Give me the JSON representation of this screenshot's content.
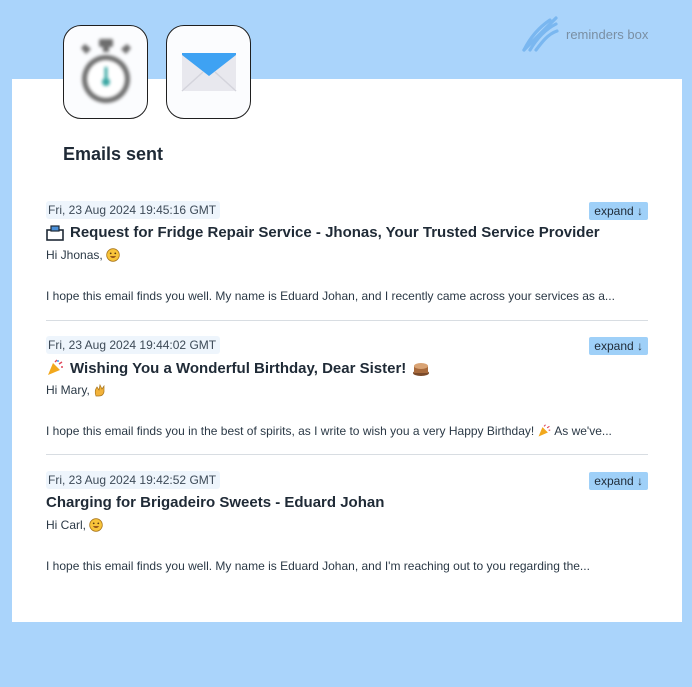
{
  "brand": {
    "label": "reminders box",
    "icon": "feather-logo-icon",
    "color": "#7ab7f0"
  },
  "tiles": [
    {
      "name": "timer",
      "icon": "stopwatch-icon"
    },
    {
      "name": "mail",
      "icon": "envelope-icon"
    }
  ],
  "section": {
    "title": "Emails sent"
  },
  "emails": [
    {
      "timestamp": "Fri, 23 Aug 2024 19:45:16 GMT",
      "expand_label": "expand ↓",
      "subject_icon": "toolbox-icon",
      "subject": "Request for Fridge Repair Service - Jhonas, Your Trusted Service Provider",
      "greeting": "Hi Jhonas,",
      "greeting_icon": "smile-emoji-icon",
      "preview": "I hope this email finds you well. My name is Eduard Johan, and I recently came across your services as a..."
    },
    {
      "timestamp": "Fri, 23 Aug 2024 19:44:02 GMT",
      "expand_label": "expand ↓",
      "subject_icon": "party-popper-icon",
      "subject": "Wishing You a Wonderful Birthday, Dear Sister!",
      "subject_trailing_icon": "cake-icon",
      "greeting": "Hi Mary,",
      "greeting_icon": "waving-hands-icon",
      "preview_start": "I hope this email finds you in the best of spirits, as I write to wish you a very Happy Birthday!",
      "preview_icon": "party-popper-icon",
      "preview_end": "As we've..."
    },
    {
      "timestamp": "Fri, 23 Aug 2024 19:42:52 GMT",
      "expand_label": "expand ↓",
      "subject": "Charging for Brigadeiro Sweets - Eduard Johan",
      "greeting": "Hi Carl,",
      "greeting_icon": "smile-emoji-icon",
      "preview": "I hope this email finds you well. My name is Eduard Johan, and I'm reaching out to you regarding the..."
    }
  ]
}
